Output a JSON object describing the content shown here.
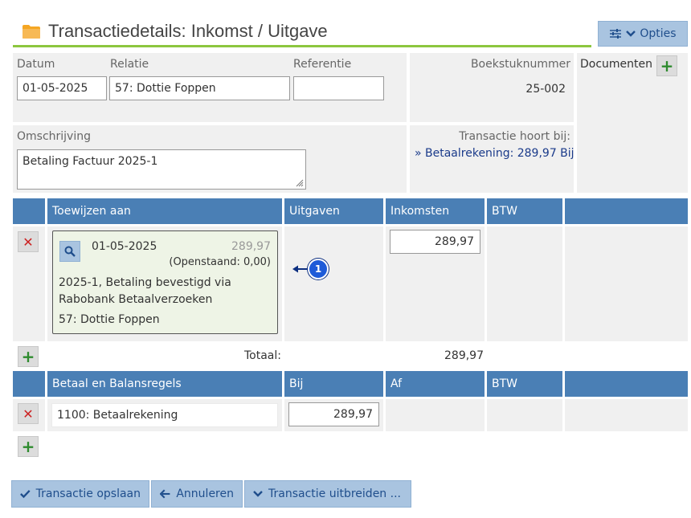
{
  "header": {
    "title": "Transactiedetails: Inkomst / Uitgave",
    "options_label": "Opties"
  },
  "form": {
    "datum_label": "Datum",
    "datum_value": "01-05-2025",
    "relatie_label": "Relatie",
    "relatie_value": "57: Dottie Foppen",
    "referentie_label": "Referentie",
    "referentie_value": "",
    "boekstuk_label": "Boekstuknummer",
    "boekstuk_value": "25-002",
    "documenten_label": "Documenten",
    "omschrijving_label": "Omschrijving",
    "omschrijving_value": "Betaling Factuur 2025-1",
    "hoort_bij_label": "Transactie hoort bij:",
    "hoort_bij_link": "» Betaalrekening: 289,97 Bij"
  },
  "allocation": {
    "headers": [
      "Toewijzen aan",
      "Uitgaven",
      "Inkomsten",
      "BTW"
    ],
    "item": {
      "date": "01-05-2025",
      "amount": "289,97",
      "outstanding": "(Openstaand: 0,00)",
      "line1": "2025-1, Betaling bevestigd via",
      "line2": "Rabobank Betaalverzoeken",
      "relation": "57: Dottie Foppen",
      "income_value": "289,97"
    },
    "marker_number": "1",
    "total_label": "Totaal:",
    "total_value": "289,97"
  },
  "balance": {
    "headers": [
      "Betaal en Balansregels",
      "Bij",
      "Af",
      "BTW"
    ],
    "row": {
      "account": "1100: Betaalrekening",
      "bij_value": "289,97"
    }
  },
  "footer": {
    "save_label": "Transactie opslaan",
    "cancel_label": "Annuleren",
    "expand_label": "Transactie uitbreiden ..."
  },
  "colors": {
    "accent_green": "#8cc63f",
    "header_blue": "#4a7fb5",
    "button_blue": "#a9c4e0",
    "delete_red": "#cc2222",
    "add_green": "#2e8b2e"
  }
}
